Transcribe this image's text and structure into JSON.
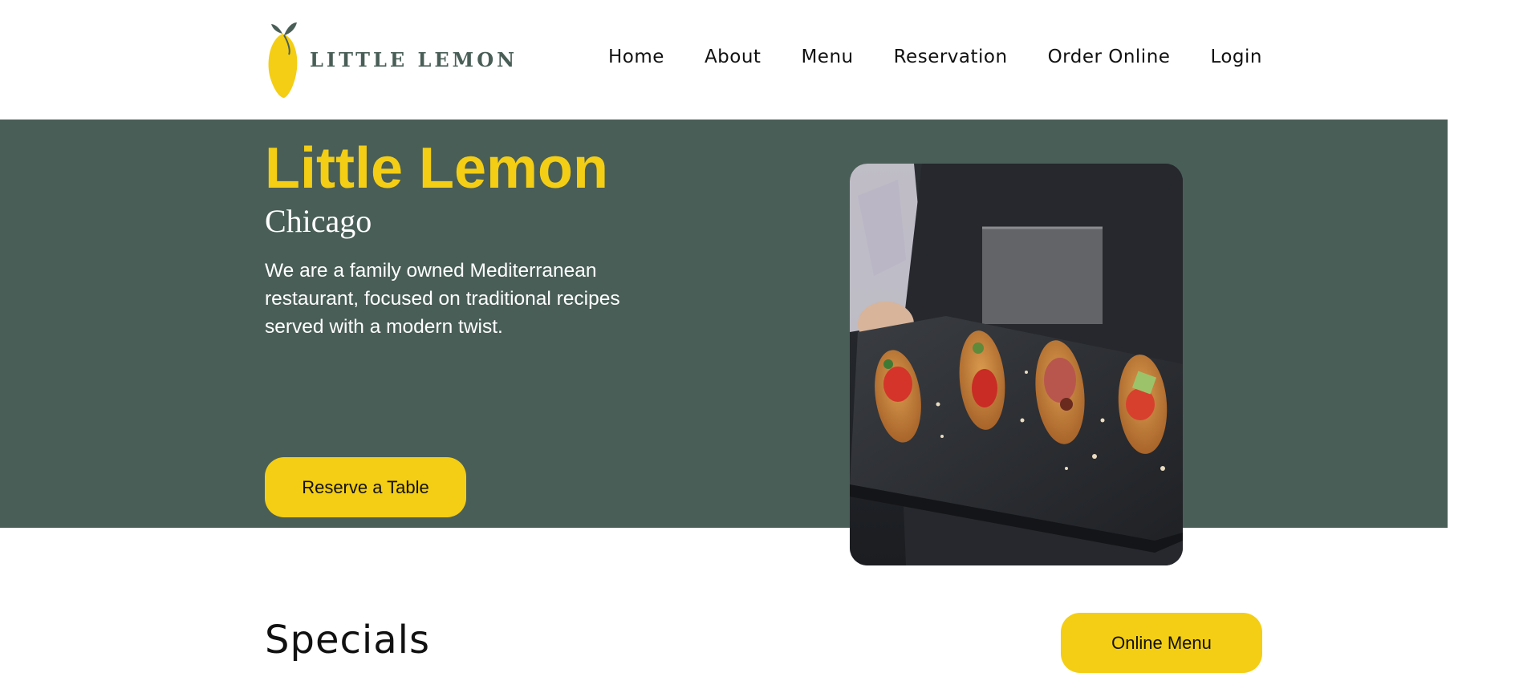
{
  "brand": {
    "logo_text": "LITTLE LEMON",
    "logo_icon": "lemon-logo-icon",
    "primary_green": "#495e57",
    "accent_yellow": "#f4ce14"
  },
  "nav": {
    "items": [
      {
        "label": "Home"
      },
      {
        "label": "About"
      },
      {
        "label": "Menu"
      },
      {
        "label": "Reservation"
      },
      {
        "label": "Order Online"
      },
      {
        "label": "Login"
      }
    ]
  },
  "hero": {
    "title": "Little Lemon",
    "subtitle": "Chicago",
    "description": "We are a family owned Mediterranean restaurant, focused on traditional recipes served with a modern twist.",
    "reserve_label": "Reserve a Table",
    "image": "bruschetta-platter-image"
  },
  "specials": {
    "title": "Specials",
    "online_menu_label": "Online Menu"
  }
}
